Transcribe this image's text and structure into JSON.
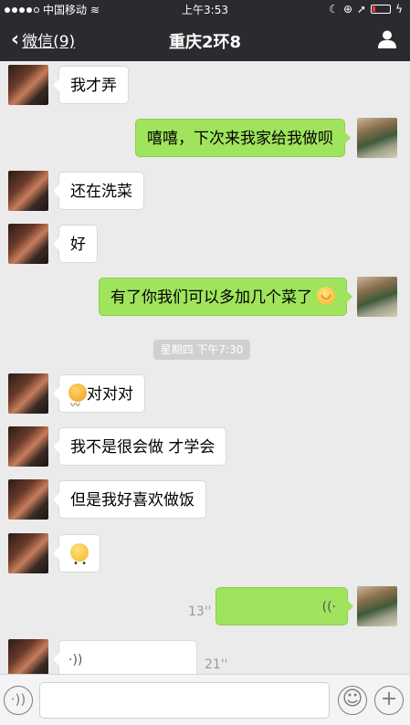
{
  "status_bar": {
    "carrier": "中国移动",
    "time": "上午3:53"
  },
  "nav": {
    "back_label": "微信(9)",
    "title": "重庆2环8"
  },
  "messages": [
    {
      "side": "in",
      "text": "我才弄"
    },
    {
      "side": "out",
      "text": "嘻嘻，下次来我家给我做呗"
    },
    {
      "side": "in",
      "text": "还在洗菜"
    },
    {
      "side": "in",
      "text": "好"
    },
    {
      "side": "out",
      "text": "有了你我们可以多加几个菜了"
    },
    {
      "type": "time",
      "text": "星期四 下午7:30"
    },
    {
      "side": "in",
      "text": "对对对"
    },
    {
      "side": "in",
      "text": "我不是很会做 才学会"
    },
    {
      "side": "in",
      "text": "但是我好喜欢做饭"
    },
    {
      "side": "in",
      "text": ""
    },
    {
      "side": "out",
      "type": "voice",
      "duration": "13''"
    },
    {
      "side": "in",
      "type": "voice",
      "duration": "21''"
    }
  ],
  "icons": {
    "back": "chevron-left-icon",
    "profile": "person-icon",
    "voice": "voice-icon",
    "emoji": "emoji-icon",
    "add": "plus-icon"
  }
}
